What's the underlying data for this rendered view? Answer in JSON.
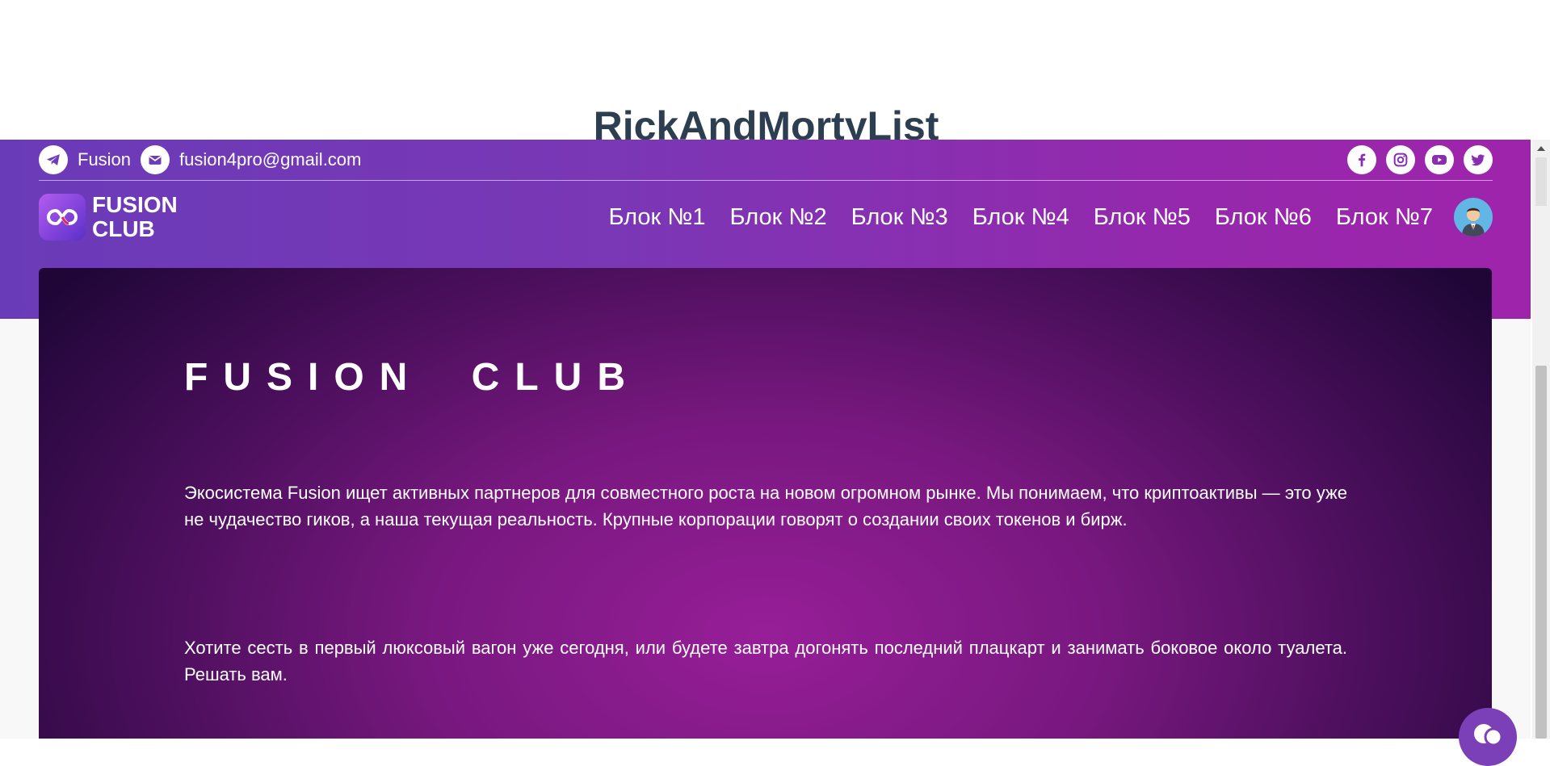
{
  "page": {
    "heading": "RickAndMortyList"
  },
  "topbar": {
    "telegram_label": "Fusion",
    "email_label": "fusion4pro@gmail.com",
    "social_icons": [
      "facebook-icon",
      "instagram-icon",
      "youtube-icon",
      "twitter-icon"
    ]
  },
  "logo": {
    "line1": "FUSION",
    "line2": "CLUB"
  },
  "nav": {
    "items": [
      {
        "label": "Блок №1"
      },
      {
        "label": "Блок №2"
      },
      {
        "label": "Блок №3"
      },
      {
        "label": "Блок №4"
      },
      {
        "label": "Блок №5"
      },
      {
        "label": "Блок №6"
      },
      {
        "label": "Блок №7"
      }
    ]
  },
  "hero": {
    "title": "FUSION CLUB",
    "paragraph1": "Экосистема Fusion ищет активных партнеров для совместного роста на новом огромном рынке. Мы понимаем, что криптоактивы — это уже не чудачество гиков, а наша текущая реальность. Крупные корпорации говорят о создании своих токенов и бирж.",
    "paragraph2": "Хотите сесть в первый люксовый вагон уже сегодня, или будете завтра догонять последний плацкарт и занимать боковое около туалета. Решать вам."
  },
  "colors": {
    "header_gradient_start": "#6a3bb8",
    "header_gradient_end": "#9e24ab",
    "hero_center": "#971e98",
    "hero_edge": "#1f0637",
    "heading_text": "#2c3e50"
  }
}
